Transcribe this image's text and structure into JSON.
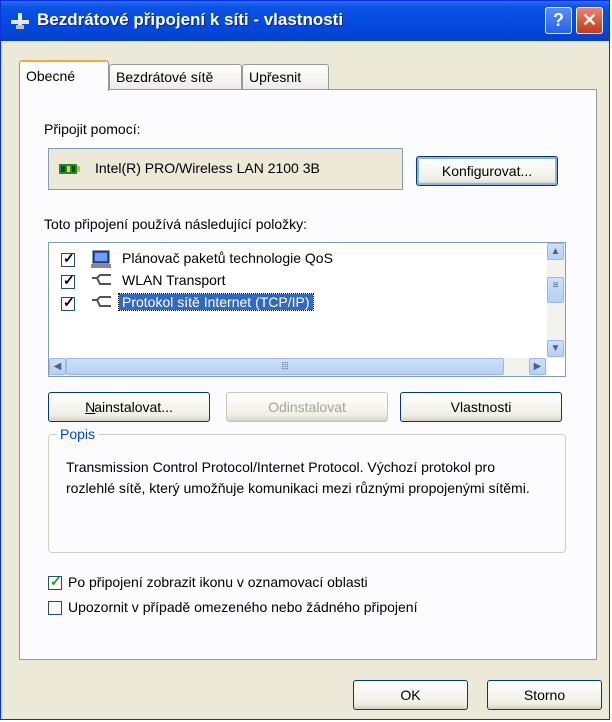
{
  "window": {
    "title": "Bezdrátové připojení k síti - vlastnosti",
    "help_label": "?",
    "close_label": "✕"
  },
  "tabs": [
    {
      "label": "Obecné",
      "active": true
    },
    {
      "label": "Bezdrátové sítě",
      "active": false
    },
    {
      "label": "Upřesnit",
      "active": false
    }
  ],
  "general": {
    "connect_using_label": "Připojit pomocí:",
    "adapter_name": "Intel(R) PRO/Wireless LAN 2100 3B",
    "configure_button": "Konfigurovat...",
    "items_label": "Toto připojení používá následující položky:",
    "components": [
      {
        "label": "Plánovač paketů technologie QoS",
        "checked": true,
        "icon": "scheduler-icon",
        "selected": false
      },
      {
        "label": "WLAN Transport",
        "checked": true,
        "icon": "network-protocol-icon",
        "selected": false
      },
      {
        "label": "Protokol sítě Internet (TCP/IP)",
        "checked": true,
        "icon": "network-protocol-icon",
        "selected": true
      }
    ],
    "install_button": "Nainstalovat...",
    "uninstall_button": "Odinstalovat",
    "properties_button": "Vlastnosti",
    "description_group_title": "Popis",
    "description_text": "Transmission Control Protocol/Internet Protocol. Výchozí protokol pro rozlehlé sítě, který umožňuje komunikaci mezi různými propojenými sítěmi.",
    "show_icon_option": {
      "label": "Po připojení zobrazit ikonu v oznamovací oblasti",
      "checked": true
    },
    "notify_option": {
      "label": "Upozornit v případě omezeného nebo žádného připojení",
      "checked": false
    }
  },
  "footer": {
    "ok_button": "OK",
    "cancel_button": "Storno"
  }
}
